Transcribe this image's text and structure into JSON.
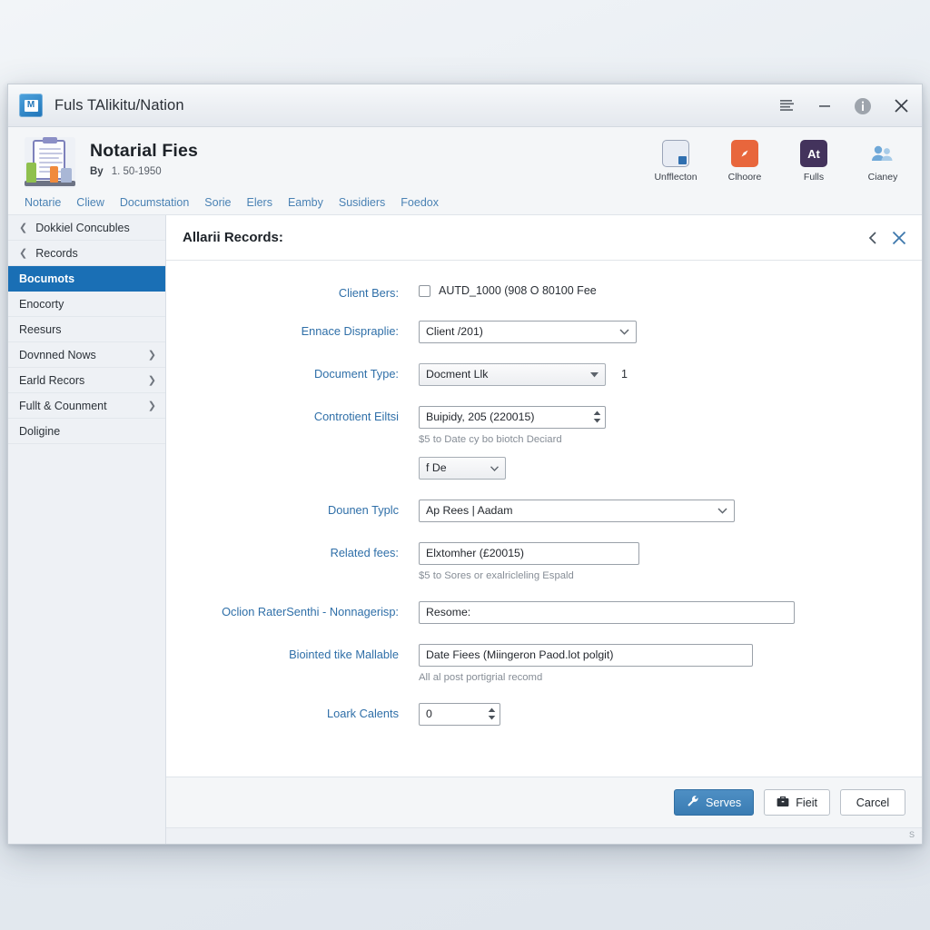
{
  "window": {
    "title": "Fuls TAlikitu/Nation",
    "controls": [
      {
        "name": "menu-icon",
        "label": "menu"
      },
      {
        "name": "minimize-icon",
        "label": "minimize"
      },
      {
        "name": "info-icon",
        "label": "info"
      },
      {
        "name": "close-icon",
        "label": "close"
      }
    ]
  },
  "header": {
    "title": "Notarial Fies",
    "by_label": "By",
    "by_value": "1. 50-1950",
    "nav": [
      "Notarie",
      "Cliew",
      "Documstation",
      "Sorie",
      "Elers",
      "Eamby",
      "Susidiers",
      "Foedox"
    ],
    "tools": [
      {
        "label": "Unfflecton",
        "icon": "document-share-icon"
      },
      {
        "label": "Clhoore",
        "icon": "compass-icon"
      },
      {
        "label": "Fulls",
        "icon": "text-format-icon"
      },
      {
        "label": "Cianey",
        "icon": "people-icon"
      }
    ]
  },
  "sidebar": {
    "items": [
      {
        "label": "Dokkiel Concubles",
        "back": true,
        "chevron": false,
        "active": false
      },
      {
        "label": "Records",
        "back": true,
        "chevron": false,
        "active": false
      },
      {
        "label": "Bocumots",
        "back": false,
        "chevron": false,
        "active": true
      },
      {
        "label": "Enocorty",
        "back": false,
        "chevron": false,
        "active": false
      },
      {
        "label": "Reesurs",
        "back": false,
        "chevron": false,
        "active": false
      },
      {
        "label": "Dovnned Nows",
        "back": false,
        "chevron": true,
        "active": false
      },
      {
        "label": "Earld Recors",
        "back": false,
        "chevron": true,
        "active": false
      },
      {
        "label": "Fullt & Counment",
        "back": false,
        "chevron": true,
        "active": false
      },
      {
        "label": "Doligine",
        "back": false,
        "chevron": false,
        "active": false
      }
    ]
  },
  "panel": {
    "title": "Allarii Records:",
    "back_icon": "chevron-left-icon",
    "close_icon": "close-icon"
  },
  "form": {
    "client_bers": {
      "label": "Client Bers:",
      "checkbox_checked": false,
      "checkbox_text": "AUTD_1000 (908 O 80100 Fee"
    },
    "ennace": {
      "label": "Ennace Dispraplie:",
      "value": "Client /201)"
    },
    "document_type": {
      "label": "Document Type:",
      "value": "Docment Llk",
      "count": "1"
    },
    "controtient": {
      "label": "Controtient Eiltsi",
      "value": "Buipidy, 205 (220015)",
      "hint": "$5 to Date cy bo biotch Deciard",
      "sub_value": "f De"
    },
    "dounen": {
      "label": "Dounen Typlc",
      "value": "Ap Rees | Aadam"
    },
    "related_fees": {
      "label": "Related fees:",
      "value": "Elxtomher (£20015)",
      "hint": "$5 to Sores or exalricleling Espald"
    },
    "ration": {
      "label": "Oclion RaterSenthi - Nonnagerisp:",
      "value": "Resome:"
    },
    "biointed": {
      "label": "Biointed tike Mallable",
      "value": "Date Fiees (Miingeron Paod.lot polgit)",
      "hint": "All al post portigrial recomd"
    },
    "loark": {
      "label": "Loark Calents",
      "value": "0"
    }
  },
  "footer": {
    "save_label": "Serves",
    "save_icon": "wrench-icon",
    "field_label": "Fieit",
    "field_icon": "briefcase-icon",
    "cancel_label": "Carcel",
    "status_glyph": "S"
  },
  "colors": {
    "accent_blue": "#1a6fb5",
    "label_blue": "#2f6fa8",
    "link_blue": "#4a82b4",
    "primary_button": "#3a7cb3"
  }
}
